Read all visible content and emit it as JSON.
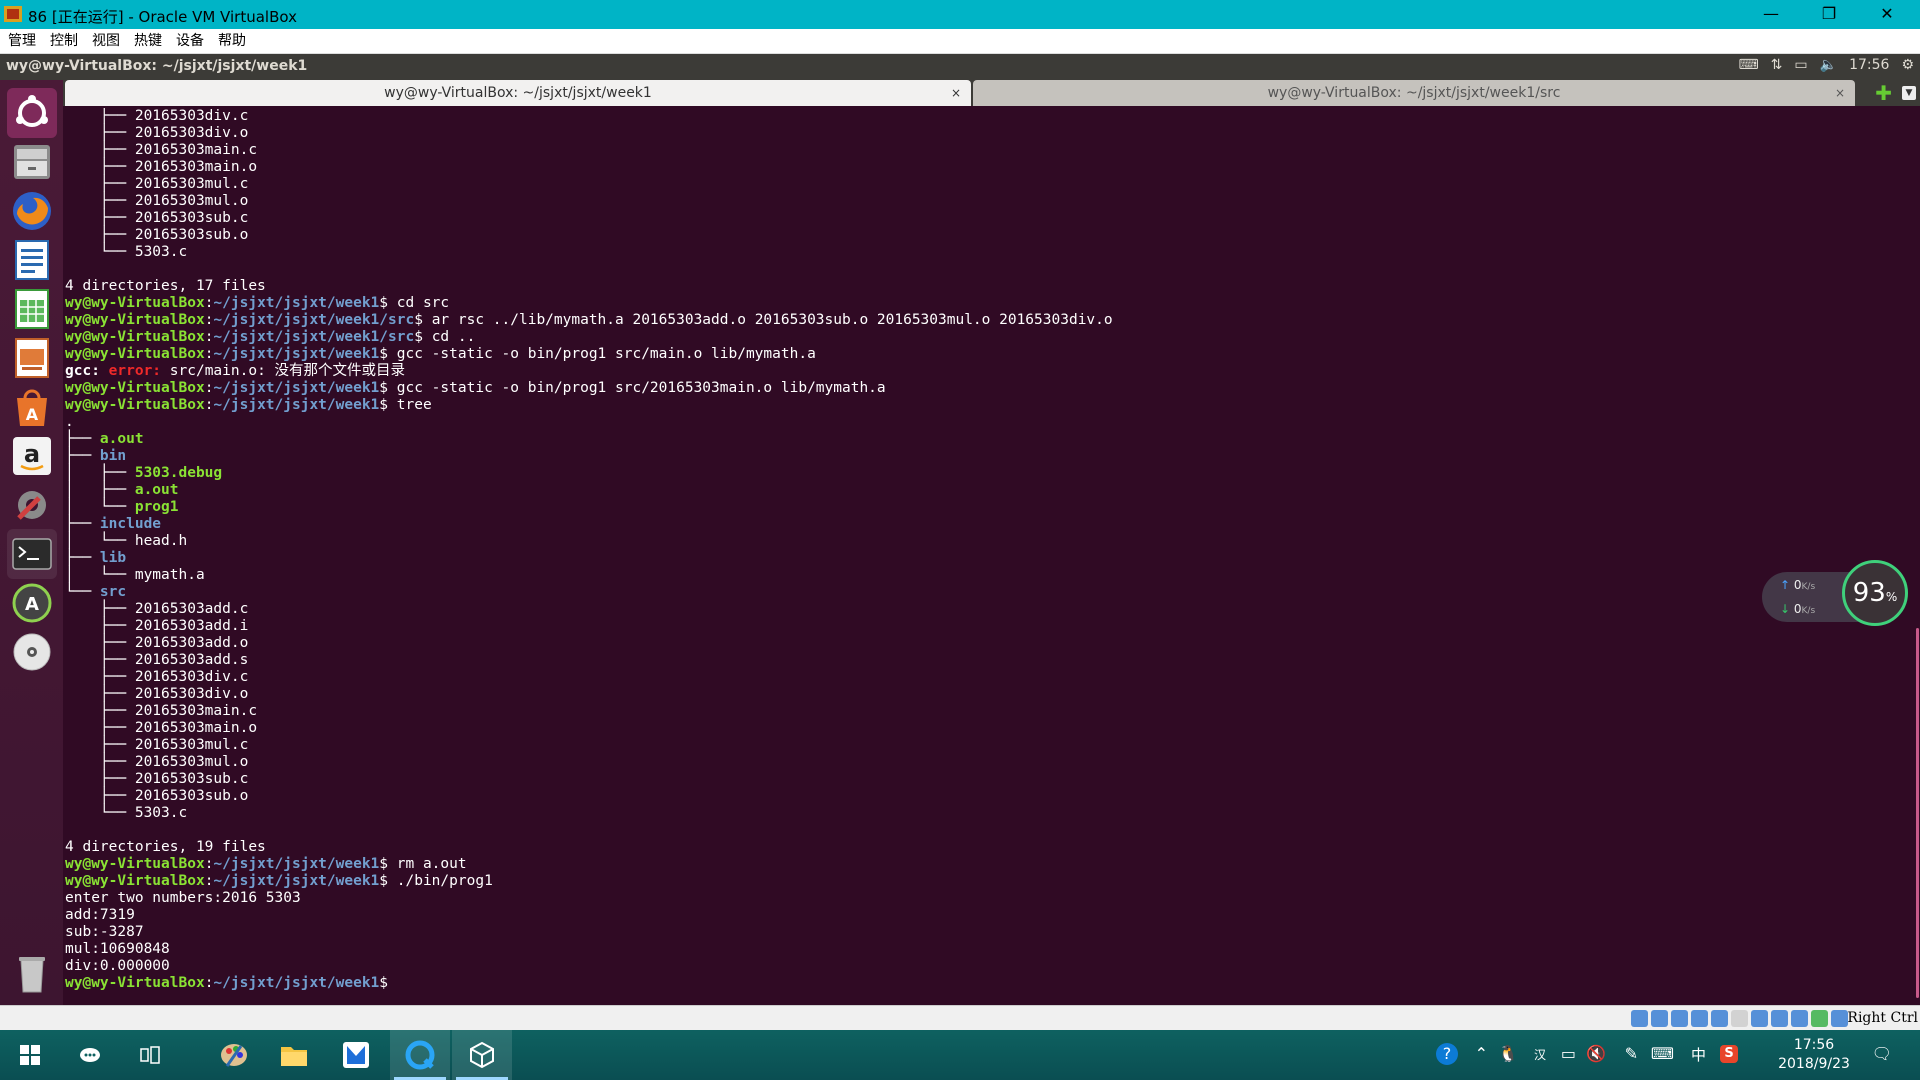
{
  "window": {
    "title": "86 [正在运行] - Oracle VM VirtualBox",
    "minimize": "—",
    "restore": "❐",
    "close": "✕"
  },
  "menubar": [
    "管理",
    "控制",
    "视图",
    "热键",
    "设备",
    "帮助"
  ],
  "ubuntu_panel": {
    "title": "wy@wy-VirtualBox: ~/jsjxt/jsjxt/week1",
    "time": "17:56"
  },
  "tabs": [
    {
      "label": "wy@wy-VirtualBox: ~/jsjxt/jsjxt/week1",
      "close": "×"
    },
    {
      "label": "wy@wy-VirtualBox: ~/jsjxt/jsjxt/week1/src",
      "close": "×"
    }
  ],
  "terminal": {
    "prompt_user": "wy@wy-VirtualBox",
    "lines_top": [
      "    ├── 20165303div.c",
      "    ├── 20165303div.o",
      "    ├── 20165303main.c",
      "    ├── 20165303main.o",
      "    ├── 20165303mul.c",
      "    ├── 20165303mul.o",
      "    ├── 20165303sub.c",
      "    ├── 20165303sub.o",
      "    └── 5303.c",
      "",
      "4 directories, 17 files"
    ],
    "commands_1": [
      {
        "path": "~/jsjxt/jsjxt/week1",
        "cmd": "cd src"
      },
      {
        "path": "~/jsjxt/jsjxt/week1/src",
        "cmd": "ar rsc ../lib/mymath.a 20165303add.o 20165303sub.o 20165303mul.o 20165303div.o"
      },
      {
        "path": "~/jsjxt/jsjxt/week1/src",
        "cmd": "cd .."
      },
      {
        "path": "~/jsjxt/jsjxt/week1",
        "cmd": "gcc -static -o bin/prog1 src/main.o lib/mymath.a"
      }
    ],
    "error": {
      "prefix": "gcc:",
      "label": "error:",
      "msg": "src/main.o: 没有那个文件或目录"
    },
    "commands_2": [
      {
        "path": "~/jsjxt/jsjxt/week1",
        "cmd": "gcc -static -o bin/prog1 src/20165303main.o lib/mymath.a"
      },
      {
        "path": "~/jsjxt/jsjxt/week1",
        "cmd": "tree"
      }
    ],
    "tree": {
      "root": ".",
      "aout": "a.out",
      "bin": "bin",
      "bin_items": [
        "5303.debug",
        "a.out",
        "prog1"
      ],
      "include": "include",
      "include_items": [
        "head.h"
      ],
      "lib": "lib",
      "lib_items": [
        "mymath.a"
      ],
      "src": "src",
      "src_items": [
        "20165303add.c",
        "20165303add.i",
        "20165303add.o",
        "20165303add.s",
        "20165303div.c",
        "20165303div.o",
        "20165303main.c",
        "20165303main.o",
        "20165303mul.c",
        "20165303mul.o",
        "20165303sub.c",
        "20165303sub.o",
        "5303.c"
      ],
      "summary": "4 directories, 19 files"
    },
    "commands_3": [
      {
        "path": "~/jsjxt/jsjxt/week1",
        "cmd": "rm a.out"
      },
      {
        "path": "~/jsjxt/jsjxt/week1",
        "cmd": "./bin/prog1"
      }
    ],
    "output": [
      "enter two numbers:2016 5303",
      "add:7319",
      "sub:-3287",
      "mul:10690848",
      "div:0.000000"
    ],
    "final_path": "~/jsjxt/jsjxt/week1"
  },
  "speed_widget": {
    "up": "0",
    "down": "0",
    "unit": "K/s",
    "percent": "93",
    "percent_sign": "%"
  },
  "vbox_status": {
    "host_key": "Right Ctrl"
  },
  "taskbar": {
    "clock_time": "17:56",
    "clock_date": "2018/9/23",
    "ime": "中",
    "items": [
      "windows-start",
      "cortana",
      "task-view",
      "paint",
      "file-explorer",
      "app-blue",
      "qq-browser",
      "virtualbox"
    ]
  },
  "colors": {
    "terminal_bg": "#300a24",
    "prompt_green": "#8ae234",
    "path_blue": "#729fcf",
    "titlebar": "#00b4c6",
    "taskbar": "#0e6160"
  }
}
